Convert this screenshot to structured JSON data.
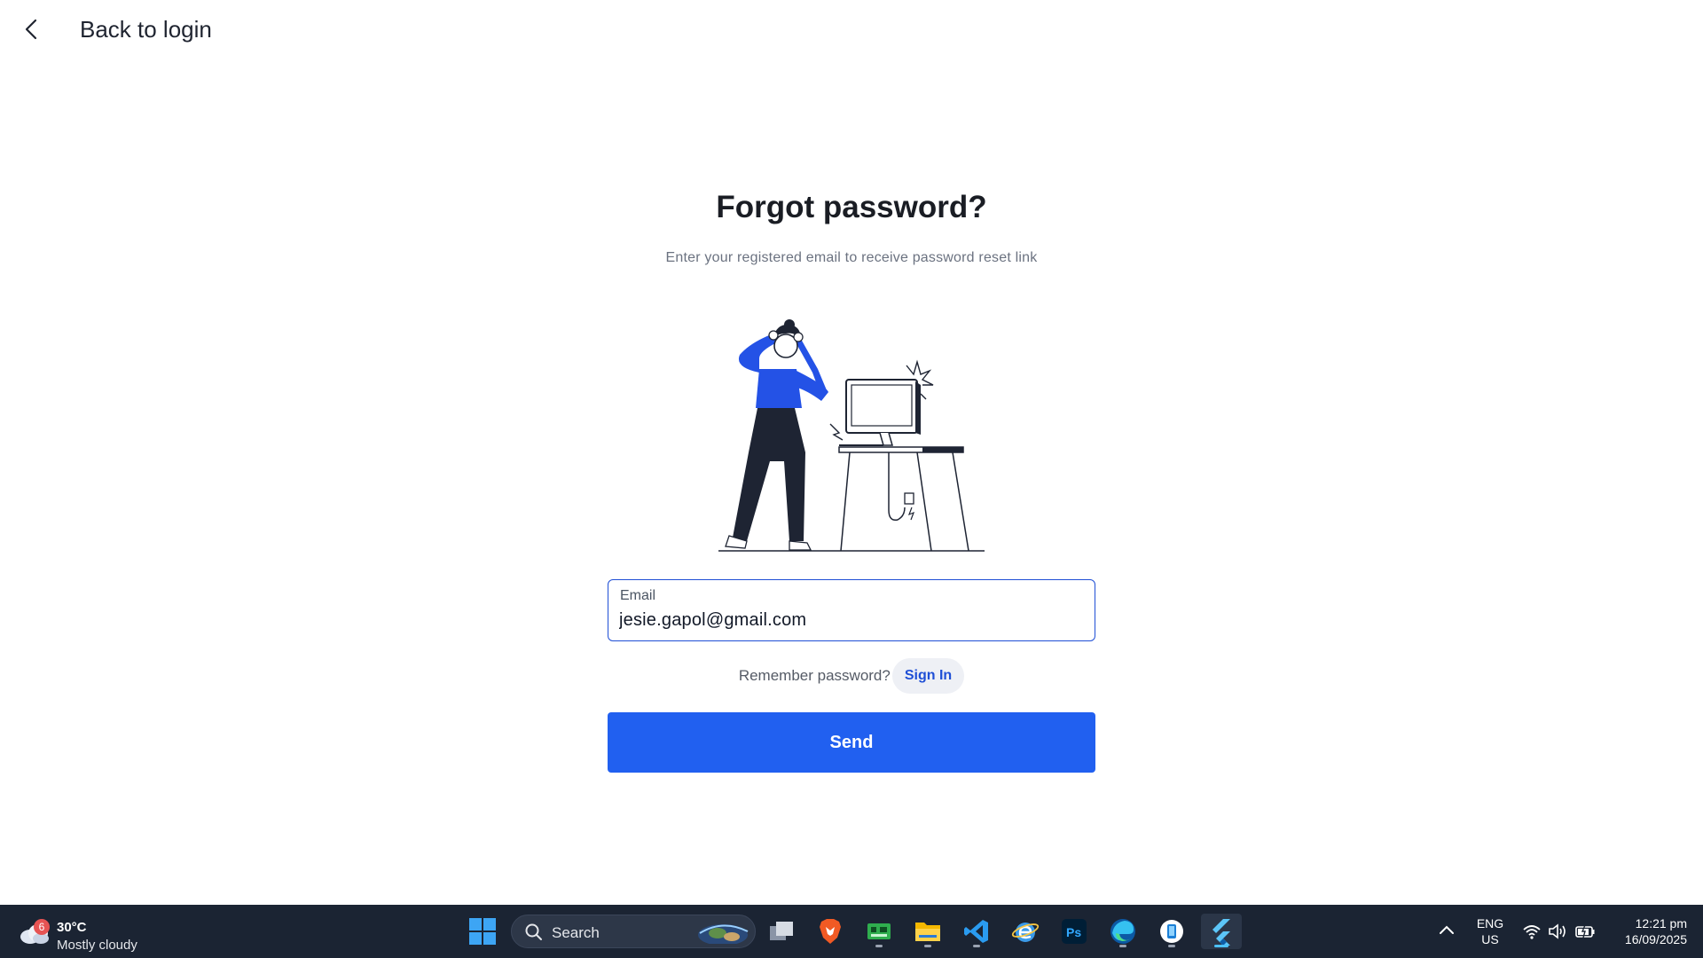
{
  "header": {
    "back_label": "Back to login"
  },
  "main": {
    "title": "Forgot password?",
    "subtitle": "Enter your registered email to receive password reset link",
    "email_field": {
      "label": "Email",
      "value": "jesie.gapol@gmail.com"
    },
    "remember_text": "Remember password?",
    "signin_label": "Sign In",
    "send_label": "Send"
  },
  "taskbar": {
    "weather": {
      "badge": "6",
      "temp": "30°C",
      "desc": "Mostly cloudy"
    },
    "search_label": "Search",
    "apps": [
      "task-view",
      "brave",
      "tool",
      "file-explorer",
      "vscode",
      "browser-e",
      "photoshop",
      "edge",
      "phone-app",
      "flutter"
    ],
    "lang_line1": "ENG",
    "lang_line2": "US",
    "time": "12:21 pm",
    "date": "16/09/2025"
  },
  "colors": {
    "accent": "#2160f0",
    "taskbar": "#1b2433",
    "text": "#1a1d24"
  }
}
